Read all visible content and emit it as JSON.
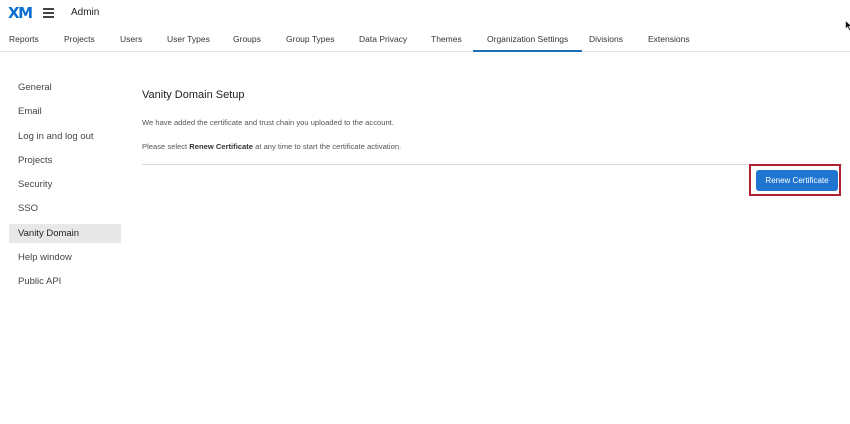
{
  "header": {
    "logo_text": "XM",
    "app_title": "Admin",
    "brand_color": "#0b6ed0"
  },
  "tabs": [
    {
      "label": "Reports"
    },
    {
      "label": "Projects"
    },
    {
      "label": "Users"
    },
    {
      "label": "User Types"
    },
    {
      "label": "Groups"
    },
    {
      "label": "Group Types"
    },
    {
      "label": "Data Privacy"
    },
    {
      "label": "Themes"
    },
    {
      "label": "Organization Settings",
      "active": true
    },
    {
      "label": "Divisions"
    },
    {
      "label": "Extensions"
    }
  ],
  "sidebar": {
    "items": [
      {
        "label": "General"
      },
      {
        "label": "Email"
      },
      {
        "label": "Log in and log out"
      },
      {
        "label": "Projects"
      },
      {
        "label": "Security"
      },
      {
        "label": "SSO"
      },
      {
        "label": "Vanity Domain",
        "active": true
      },
      {
        "label": "Help window"
      },
      {
        "label": "Public API"
      }
    ]
  },
  "main": {
    "title": "Vanity Domain Setup",
    "message1": "We have added the certificate and trust chain you uploaded to the account.",
    "message2_prefix": "Please select ",
    "message2_bold": "Renew Certificate",
    "message2_suffix": " at any time to start the certificate activation.",
    "renew_button_label": "Renew Certificate",
    "button_color": "#1f75cf",
    "highlight_color": "#b0202e"
  }
}
